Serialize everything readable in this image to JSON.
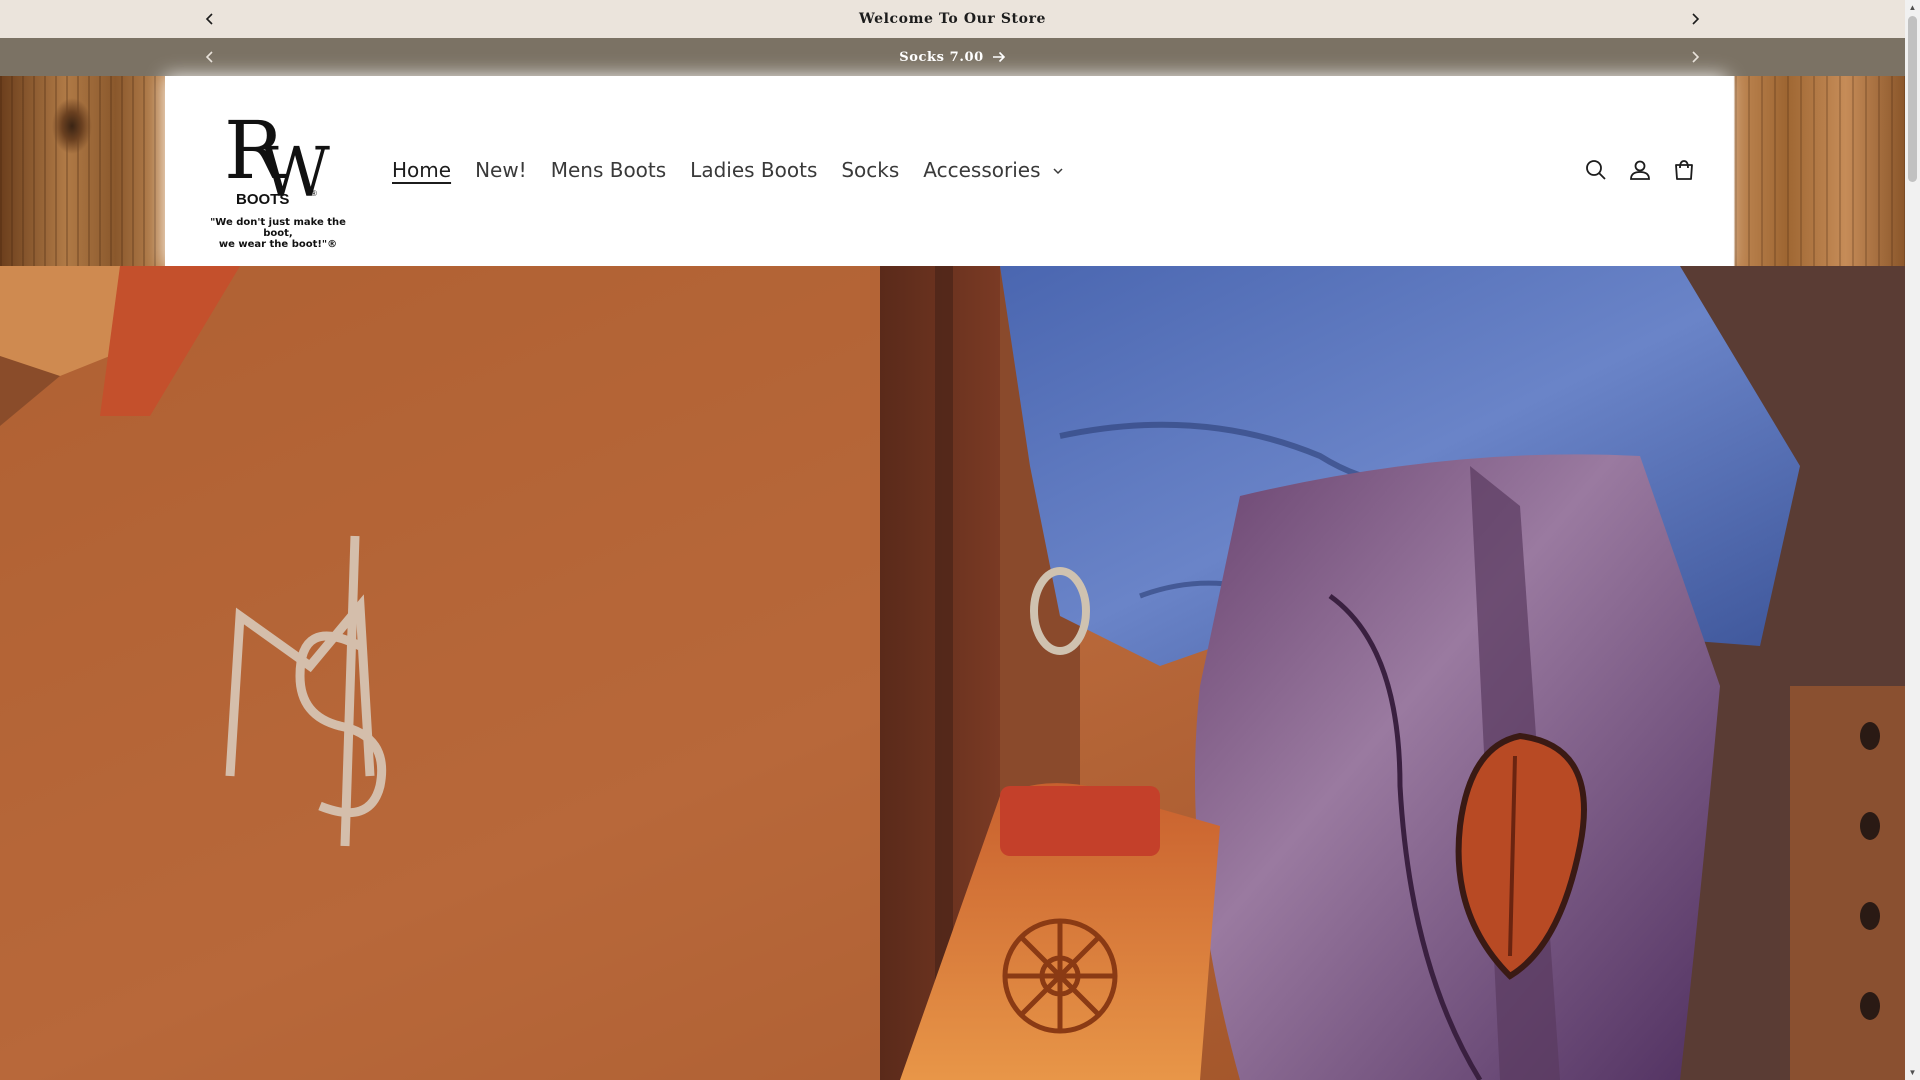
{
  "announcements": [
    {
      "text": "Welcome To Our Store"
    },
    {
      "text": "Socks 7.00"
    }
  ],
  "logo": {
    "letters": "RW",
    "wordmark": "BOOTS",
    "registered": "®",
    "tagline_line1": "\"We don't just make the boot,",
    "tagline_line2": "we wear the boot!\"®"
  },
  "nav": {
    "items": [
      {
        "label": "Home",
        "active": true
      },
      {
        "label": "New!"
      },
      {
        "label": "Mens Boots"
      },
      {
        "label": "Ladies Boots"
      },
      {
        "label": "Socks"
      },
      {
        "label": "Accessories",
        "dropdown": true
      }
    ]
  },
  "header_icons": [
    "search-icon",
    "account-icon",
    "cart-icon"
  ],
  "colors": {
    "announcement_bar_1": "#ebe4dc",
    "announcement_bar_2": "#7b7264",
    "text_dark": "#1c1c1c"
  }
}
